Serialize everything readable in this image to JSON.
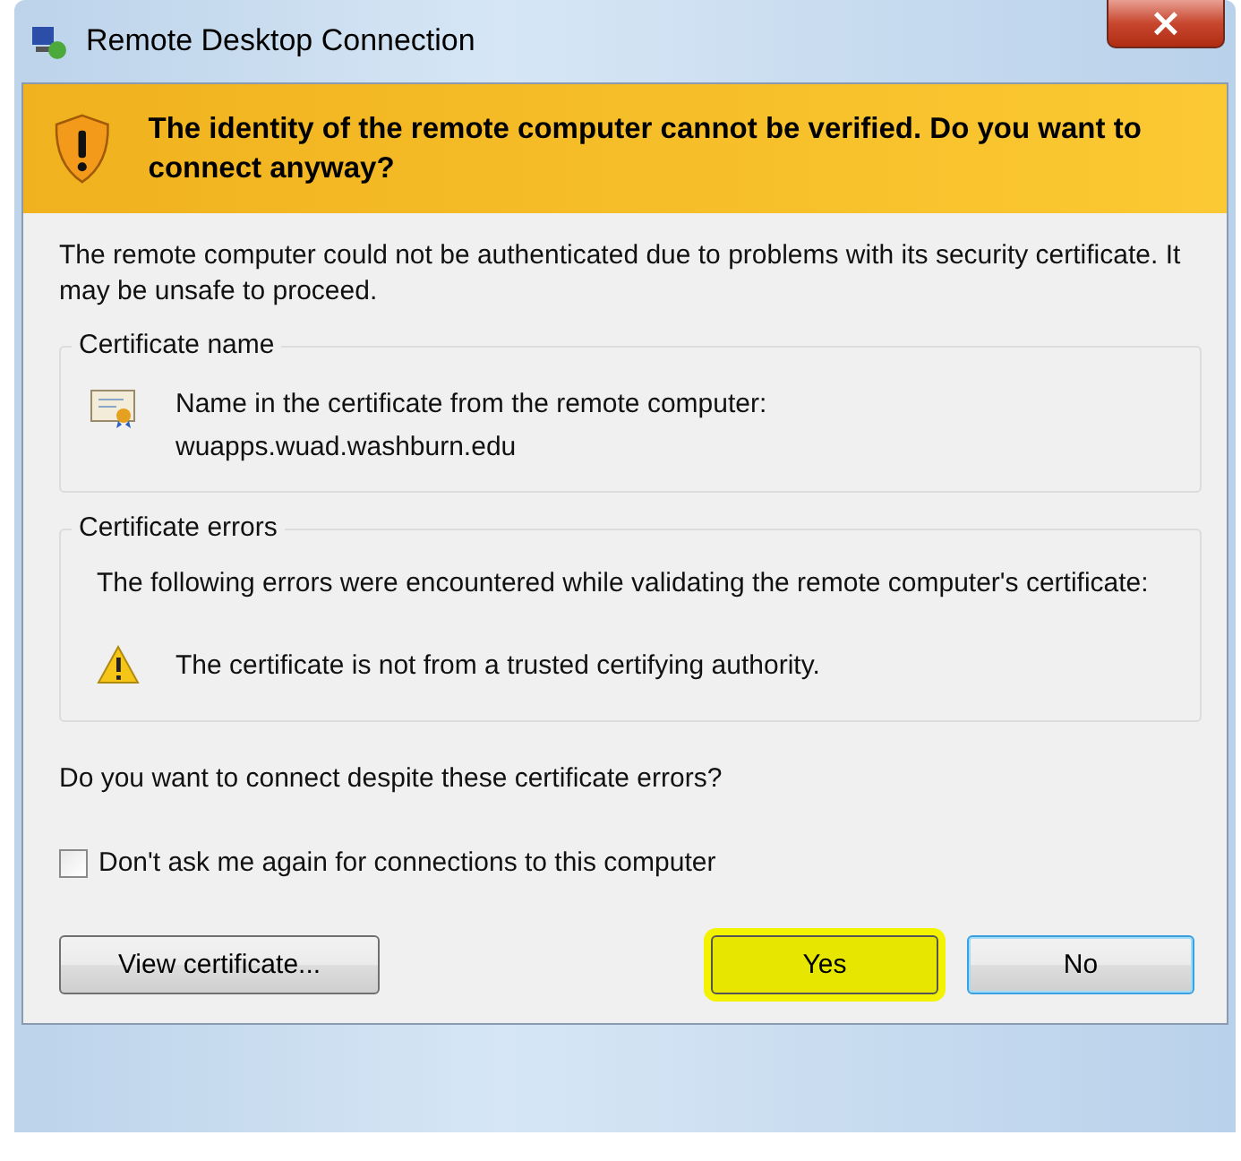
{
  "window": {
    "title": "Remote Desktop Connection",
    "close": "×"
  },
  "banner": {
    "text": "The identity of the remote computer cannot be verified. Do you want to connect anyway?"
  },
  "intro": "The remote computer could not be authenticated due to problems with its security certificate. It may be unsafe to proceed.",
  "certificate_name": {
    "legend": "Certificate name",
    "label": "Name in the certificate from the remote computer:",
    "value": "wuapps.wuad.washburn.edu"
  },
  "certificate_errors": {
    "legend": "Certificate errors",
    "text": "The following errors were encountered while validating the remote computer's certificate:",
    "errors": [
      "The certificate is not from a trusted certifying authority."
    ]
  },
  "question": "Do you want to connect despite these certificate errors?",
  "dont_ask": {
    "label": "Don't ask me again for connections to this computer",
    "checked": false
  },
  "buttons": [
    {
      "label": "View certificate...",
      "kind": "left",
      "focused": false,
      "highlighted": false
    },
    {
      "label": "Yes",
      "kind": "right",
      "focused": false,
      "highlighted": true
    },
    {
      "label": "No",
      "kind": "right",
      "focused": true,
      "highlighted": false
    }
  ]
}
